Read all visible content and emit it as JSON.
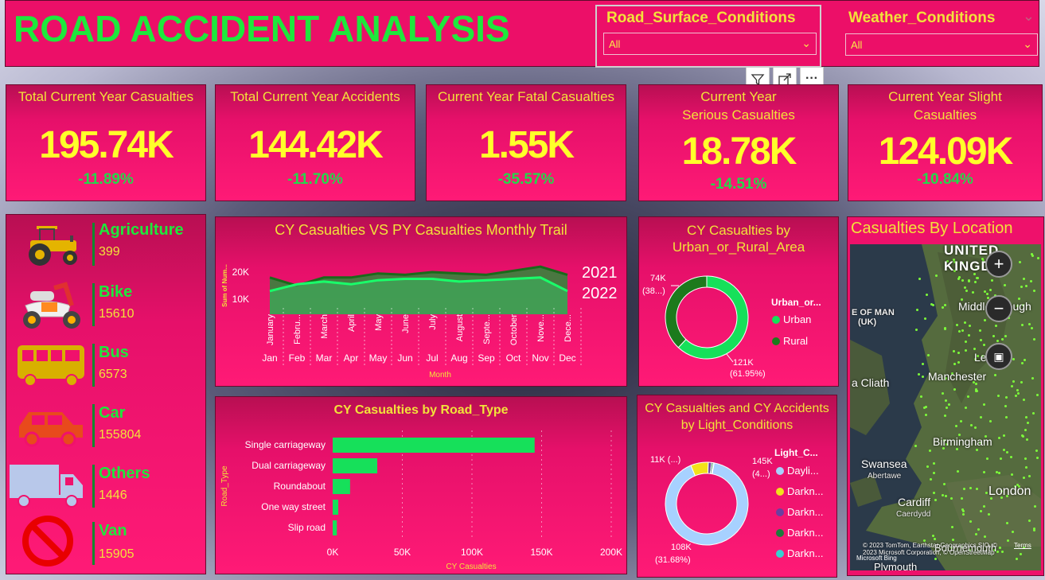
{
  "header": {
    "title": "ROAD ACCIDENT ANALYSIS",
    "slicer1": {
      "title": "Road_Surface_Conditions",
      "value": "All"
    },
    "slicer2": {
      "title": "Weather_Conditions",
      "value": "All"
    }
  },
  "toolbar": {
    "filter_icon": "filter-icon",
    "focus_icon": "focus-mode-icon",
    "more_label": "···"
  },
  "kpis": [
    {
      "title": "Total Current Year Casualties",
      "value": "195.74K",
      "delta": "-11.89%"
    },
    {
      "title": "Total Current Year Accidents",
      "value": "144.42K",
      "delta": "-11.70%"
    },
    {
      "title": "Current Year Fatal Casualties",
      "value": "1.55K",
      "delta": "-35.57%"
    },
    {
      "title": "Current Year Serious Casualties",
      "value": "18.78K",
      "delta": "-14.51%"
    },
    {
      "title": "Current Year Slight Casualties",
      "value": "124.09K",
      "delta": "-10.84%"
    }
  ],
  "vehicles": [
    {
      "name": "Agriculture",
      "count": "399",
      "icon": "tractor-icon"
    },
    {
      "name": "Bike",
      "count": "15610",
      "icon": "motorbike-icon"
    },
    {
      "name": "Bus",
      "count": "6573",
      "icon": "bus-icon"
    },
    {
      "name": "Car",
      "count": "155804",
      "icon": "car-icon"
    },
    {
      "name": "Others",
      "count": "1446",
      "icon": "truck-icon"
    },
    {
      "name": "Van",
      "count": "15905",
      "icon": "prohibited-icon"
    }
  ],
  "colors": {
    "green": "#1ee83c",
    "yellow": "#f2e23a",
    "panel": "#f0116c",
    "dark_green": "#1c7a1c",
    "light_green": "#16e05a"
  },
  "monthly_chart": {
    "title": "CY Casualties VS PY Casualties Monthly Trail",
    "ylabel": "Sum of Num...",
    "xlabel": "Month",
    "yticks": [
      "20K",
      "10K"
    ],
    "legend": [
      "2021",
      "2022"
    ]
  },
  "urban_chart": {
    "title": "CY Casualties by Urban_or_Rural_Area",
    "legend_title": "Urban_or...",
    "label_rural": "74K",
    "label_rural_pct": "(38...)",
    "label_urban": "121K",
    "label_urban_pct": "(61.95%)"
  },
  "road_chart": {
    "title": "CY Casualties by Road_Type",
    "ylabel": "Road_Type",
    "xlabel": "CY Casualties",
    "xticks": [
      "0K",
      "50K",
      "100K",
      "150K",
      "200K"
    ]
  },
  "light_chart": {
    "title": "CY Casualties and CY Accidents by Light_Conditions",
    "legend_title": "Light_C...",
    "label_top_left": "11K (...)",
    "label_top_right": "145K",
    "label_top_right_pct": "(4...)",
    "label_bottom": "108K",
    "label_bottom_pct": "(31.68%)"
  },
  "map": {
    "title": "Casualties By Location",
    "labels": {
      "united": "UNITED",
      "kingdom": "KINGDO",
      "isle_of_man": "E OF MAN",
      "uk": "(UK)",
      "middlesbrough": "Middlesbrough",
      "leeds": "Leed",
      "manchester": "Manchester",
      "cliath": "a Cliath",
      "birmingham": "Birmingham",
      "swansea": "Swansea",
      "abertawe": "Abertawe",
      "cardiff": "Cardiff",
      "caerdydd": "Caerdydd",
      "london": "London",
      "plymouth": "Plymouth",
      "bournemouth": "Bournemouth"
    },
    "attribution": "© 2023 TomTom, Earthstar Geographics SIO, © 2023 Microsoft Corporation, © OpenStreetMap",
    "terms": "Terms",
    "bing": "Microsoft Bing"
  },
  "chart_data": [
    {
      "type": "area",
      "title": "CY Casualties VS PY Casualties Monthly Trail",
      "xlabel": "Month",
      "ylabel": "Sum of Num...",
      "categories": [
        "Jan",
        "Feb",
        "Mar",
        "Apr",
        "May",
        "Jun",
        "Jul",
        "Aug",
        "Sep",
        "Oct",
        "Nov",
        "Dec"
      ],
      "category_long": [
        "January",
        "Febru...",
        "March",
        "April",
        "May",
        "June",
        "July",
        "August",
        "Septe...",
        "October",
        "Nove...",
        "Dece..."
      ],
      "ylim": [
        5000,
        25000
      ],
      "series": [
        {
          "name": "2021",
          "values": [
            18000,
            15000,
            18000,
            18000,
            19500,
            19000,
            20000,
            19500,
            19000,
            20500,
            22000,
            19000
          ]
        },
        {
          "name": "2022",
          "values": [
            13000,
            15500,
            16500,
            15500,
            17000,
            17500,
            17500,
            16500,
            17000,
            17500,
            18000,
            13000
          ]
        }
      ]
    },
    {
      "type": "pie",
      "title": "CY Casualties by Urban_or_Rural_Area",
      "categories": [
        "Urban",
        "Rural"
      ],
      "values": [
        121000,
        74000
      ],
      "colors": [
        "#16e05a",
        "#1c7a1c"
      ]
    },
    {
      "type": "bar",
      "title": "CY Casualties by Road_Type",
      "xlabel": "CY Casualties",
      "ylabel": "Road_Type",
      "categories": [
        "Single carriageway",
        "Dual carriageway",
        "Roundabout",
        "One way street",
        "Slip road"
      ],
      "values": [
        145000,
        32000,
        12500,
        4000,
        3000
      ],
      "xlim": [
        0,
        200000
      ]
    },
    {
      "type": "pie",
      "title": "CY Casualties and CY Accidents by Light_Conditions",
      "categories": [
        "Dayli...",
        "Darkn...",
        "Darkn...",
        "Darkn...",
        "Darkn..."
      ],
      "values": [
        145000,
        11000,
        2000,
        1000,
        600
      ],
      "colors": [
        "#a7d1ff",
        "#f2e21a",
        "#6b3fa0",
        "#1c7a3c",
        "#35d1d1"
      ]
    }
  ]
}
